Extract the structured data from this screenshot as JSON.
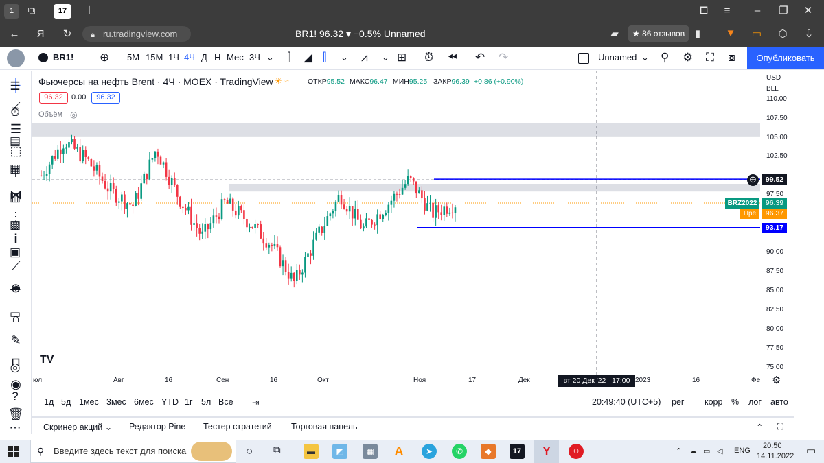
{
  "browser": {
    "tab_counter": "1",
    "url": "ru.tradingview.com",
    "title": "BR1! 96.32 ▾ −0.5% Unnamed",
    "reviews": "★ 86 отзывов",
    "icons": [
      "back-icon",
      "yandex-icon",
      "reload-icon",
      "lock-icon",
      "share-icon",
      "bookmark-icon",
      "metamask-icon",
      "battery-icon",
      "extensions-icon",
      "download-icon",
      "menu-icon",
      "minimize-icon",
      "restore-icon",
      "close-icon"
    ]
  },
  "toolbar": {
    "symbol": "BR1!",
    "intervals": [
      "5М",
      "15М",
      "1Ч",
      "4Ч",
      "Д",
      "Н",
      "Мес",
      "3Ч"
    ],
    "active_interval": "4Ч",
    "layout_name": "Unnamed",
    "publish": "Опубликовать"
  },
  "legend": {
    "title": "Фьючерсы на нефть Brent · 4Ч · MOEX · TradingView",
    "open_label": "ОТКР",
    "open": "95.52",
    "high_label": "МАКС",
    "high": "96.47",
    "low_label": "МИН",
    "low": "95.25",
    "close_label": "ЗАКР",
    "close": "96.39",
    "change": "+0.86 (+0.90%)",
    "bid": "96.32",
    "spread": "0.00",
    "ask": "96.32",
    "volume_label": "Объём"
  },
  "axis": {
    "currency": "USD",
    "unit": "BLL",
    "prices": [
      "110.00",
      "107.50",
      "105.00",
      "102.50",
      "100.00",
      "97.50",
      "95.00",
      "92.50",
      "90.00",
      "87.50",
      "85.00",
      "82.50",
      "80.00",
      "77.50",
      "75.00"
    ],
    "dates": [
      "юл",
      "Авг",
      "16",
      "Сен",
      "16",
      "Окт",
      "Ноя",
      "17",
      "Дек",
      "2023",
      "16",
      "Фе"
    ],
    "crosshair_date": "вт 20 Дек '22   17:00"
  },
  "price_tags": {
    "upper_line": "99.52",
    "symbol_tag": "BRZ2022",
    "last": "96.39",
    "pre_label": "Пре",
    "pre": "96.37",
    "lower_line": "93.17",
    "color_up": "#089981",
    "color_pre": "#ff9800",
    "color_line": "#0000ff"
  },
  "chart_data": {
    "type": "candlestick",
    "title": "Фьючерсы на нефть Brent · 4Ч · MOEX · TradingView",
    "ylim": [
      75,
      110
    ],
    "x": [
      "юл",
      "Авг",
      "16",
      "Сен",
      "16",
      "Окт",
      "Ноя",
      "17",
      "Дек",
      "2023",
      "16",
      "Фе"
    ],
    "series": [
      {
        "name": "BR1!",
        "values": [
          100.0,
          104.5,
          102.0,
          98.0,
          96.0,
          103.5,
          97.0,
          92.0,
          96.5,
          94.0,
          91.0,
          86.0,
          92.0,
          97.5,
          93.0,
          96.0,
          99.5,
          95.0,
          96.39
        ]
      }
    ],
    "zones": [
      [
        105.0,
        106.8
      ],
      [
        97.9,
        98.9
      ]
    ],
    "hlines": [
      99.52,
      93.17
    ]
  },
  "range_bar": {
    "ranges": [
      "1д",
      "5д",
      "1мес",
      "3мес",
      "6мес",
      "YTD",
      "1г",
      "5л",
      "Все"
    ],
    "time": "20:49:40 (UTC+5)",
    "options": [
      "рег",
      "корр",
      "%",
      "лог",
      "авто"
    ]
  },
  "panels": [
    "Скринер акций",
    "Редактор Pine",
    "Тестер стратегий",
    "Торговая панель"
  ],
  "taskbar": {
    "search": "Введите здесь текст для поиска",
    "lang": "ENG",
    "time": "20:50",
    "date": "14.11.2022"
  }
}
